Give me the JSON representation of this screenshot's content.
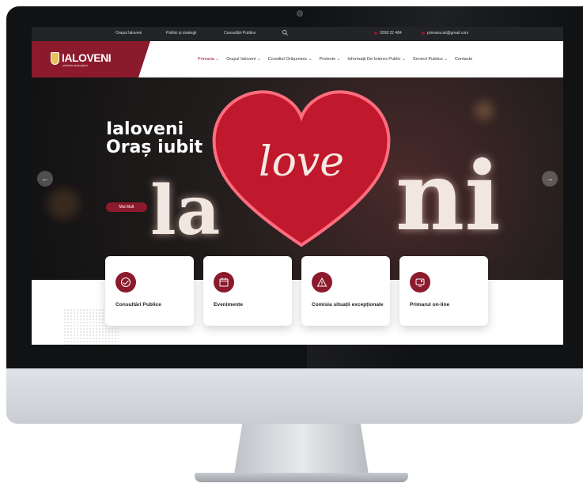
{
  "topbar": {
    "links": [
      "Orașul Ialoveni",
      "Politici și strategii",
      "Consultări Publice"
    ],
    "phone": "0268 22 484",
    "email": "primaria.ial@gmail.com"
  },
  "logo": {
    "name": "IALOVENI",
    "subtitle": "primăria municipiului"
  },
  "nav": {
    "items": [
      "Primaria ⌄",
      "Orașul Ialoveni ⌄",
      "Consiliul Orășenesc ⌄",
      "Proiecte ⌄",
      "Informații De Interes Public ⌄",
      "Servicii Publice ⌄",
      "Contacte"
    ]
  },
  "hero": {
    "title_line1": "Ialoveni",
    "title_line2": "Oraș iubit",
    "heart_text": "love",
    "button": "Mai Mult",
    "prev_arrow": "←",
    "next_arrow": "→",
    "sign_letters": [
      "la",
      "ni"
    ]
  },
  "cards": [
    {
      "label": "Consultări Publice",
      "icon": "handshake-icon"
    },
    {
      "label": "Evenimente",
      "icon": "calendar-icon"
    },
    {
      "label": "Comisia situații excepționale",
      "icon": "warning-icon"
    },
    {
      "label": "Primarul on-line",
      "icon": "monitor-icon"
    }
  ],
  "colors": {
    "accent": "#8b1a2c",
    "topbar": "#222428"
  }
}
